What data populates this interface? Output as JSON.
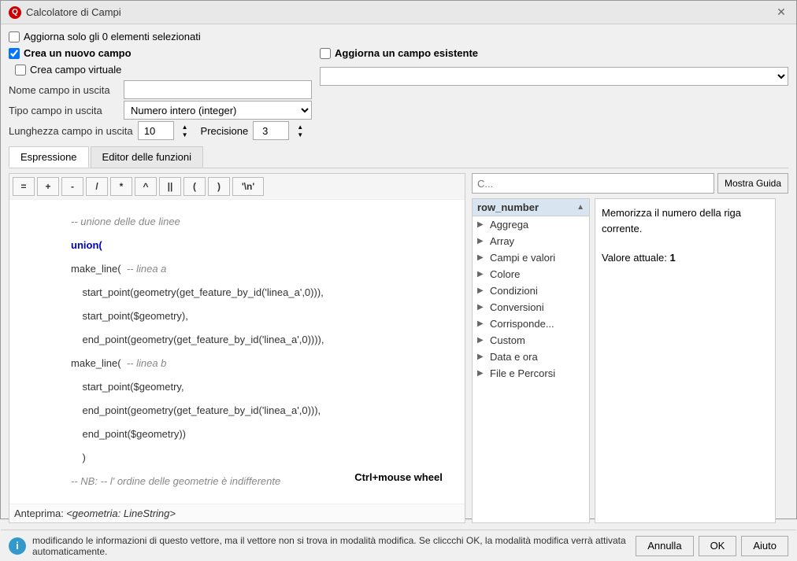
{
  "window": {
    "title": "Calcolatore di Campi",
    "close_label": "✕"
  },
  "top": {
    "update_selected_label": "Aggiorna solo gli 0 elementi selezionati",
    "create_new_field_label": "Crea un nuovo campo",
    "create_new_field_checked": true,
    "update_existing_label": "Aggiorna un campo esistente",
    "create_virtual_label": "Crea campo virtuale"
  },
  "fields": {
    "name_label": "Nome campo in uscita",
    "type_label": "Tipo campo in uscita",
    "type_value": "Numero intero (integer)",
    "length_label": "Lunghezza campo in uscita",
    "length_value": "10",
    "precision_label": "Precisione",
    "precision_value": "3"
  },
  "tabs": {
    "expression_label": "Espressione",
    "function_editor_label": "Editor delle funzioni"
  },
  "toolbar": {
    "equal": "=",
    "plus": "+",
    "minus": "-",
    "divide": "/",
    "multiply": "*",
    "power": "^",
    "pipe": "||",
    "open_paren": "(",
    "close_paren": ")",
    "newline": "'\\n'"
  },
  "expression": {
    "comment1": "-- unione delle due linee",
    "line1": "union(",
    "line2": "make_line(  -- linea a",
    "line3": "    start_point(geometry(get_feature_by_id('linea_a',0))),",
    "line4": "    start_point($geometry),",
    "line5": "    end_point(geometry(get_feature_by_id('linea_a',0)))),",
    "line6": "make_line(  -- linea b",
    "line7": "    start_point($geometry,",
    "line8": "    end_point(geometry(get_feature_by_id('linea_a',0))),",
    "line9": "    end_point($geometry))",
    "line10": "    )",
    "comment2": "-- NB: -- l' ordine delle geometrie è indifferente",
    "preview_label": "Anteprima:",
    "preview_value": "<geometria: LineString>"
  },
  "search": {
    "placeholder": "C...",
    "guide_label": "Mostra Guida"
  },
  "functions_list": {
    "header": "row_number",
    "items": [
      {
        "label": "Aggrega",
        "has_arrow": true
      },
      {
        "label": "Array",
        "has_arrow": true
      },
      {
        "label": "Campi e valori",
        "has_arrow": true
      },
      {
        "label": "Colore",
        "has_arrow": true
      },
      {
        "label": "Condizioni",
        "has_arrow": true
      },
      {
        "label": "Conversioni",
        "has_arrow": true
      },
      {
        "label": "Corrisponde...",
        "has_arrow": true
      },
      {
        "label": "Custom",
        "has_arrow": true,
        "selected": false
      },
      {
        "label": "Data e ora",
        "has_arrow": true
      },
      {
        "label": "File e Percorsi",
        "has_arrow": true
      }
    ]
  },
  "info_panel": {
    "text1": "Memorizza il numero della riga corrente.",
    "text2": "Valore attuale:",
    "value": "1"
  },
  "bottom": {
    "message": "modificando le informazioni di questo vettore, ma il vettore non si trova in modalità modifica. Se cliccchi OK, la modalità modifica verrà attivata automaticamente.",
    "annulla_label": "Annulla",
    "ok_label": "OK",
    "aiuto_label": "Aiuto"
  },
  "overlay": {
    "text": "Ctrl+mouse wheel"
  }
}
